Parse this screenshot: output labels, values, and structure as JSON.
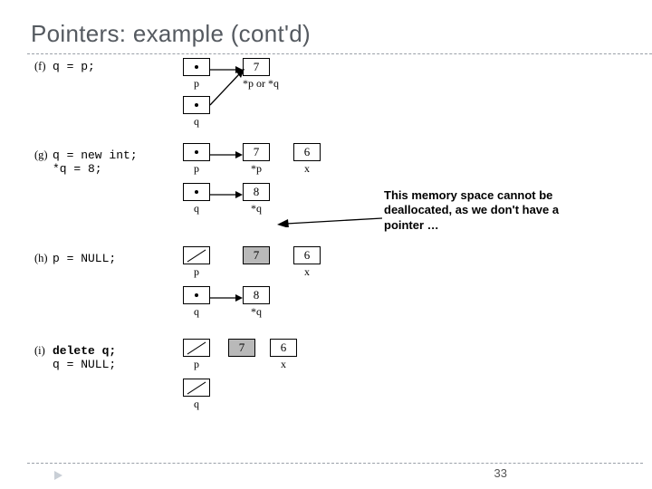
{
  "title": "Pointers: example (cont'd)",
  "page_number": "33",
  "callout": "This memory space cannot be deallocated, as we don't have a pointer …",
  "steps": {
    "f": {
      "label": "(f)",
      "code": "q = p;"
    },
    "g": {
      "label": "(g)",
      "code1": "q = new int;",
      "code2": "*q = 8;"
    },
    "h": {
      "label": "(h)",
      "code": "p = NULL;"
    },
    "i": {
      "label": "(i)",
      "code1": "delete q;",
      "code2": "q = NULL;"
    }
  },
  "values": {
    "seven": "7",
    "six": "6",
    "eight": "8"
  },
  "labels": {
    "p": "p",
    "q": "q",
    "x": "x",
    "sp": "*p",
    "sq": "*q",
    "sp_or_sq": "*p or *q"
  }
}
